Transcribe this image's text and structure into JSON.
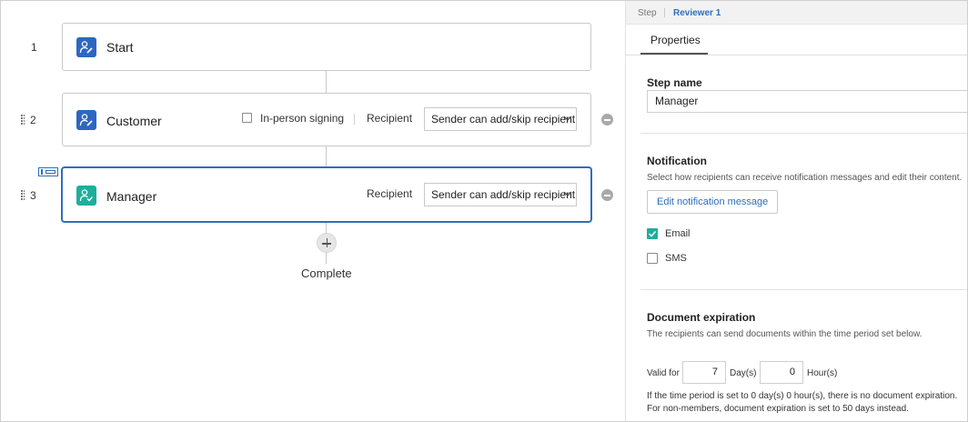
{
  "flow": {
    "steps": [
      {
        "number": "1",
        "title": "Start"
      },
      {
        "number": "2",
        "title": "Customer",
        "checkbox_label": "In-person signing",
        "recipient_label": "Recipient",
        "recipient_value": "Sender can add/skip recipient"
      },
      {
        "number": "3",
        "title": "Manager",
        "recipient_label": "Recipient",
        "recipient_value": "Sender can add/skip recipient"
      }
    ],
    "complete_label": "Complete"
  },
  "panel": {
    "breadcrumb": {
      "step": "Step",
      "current": "Reviewer 1"
    },
    "tab": "Properties",
    "step_name": {
      "title": "Step name",
      "value": "Manager"
    },
    "notification": {
      "title": "Notification",
      "description": "Select how recipients can receive notification messages and edit their content.",
      "edit_button": "Edit notification message",
      "email_label": "Email",
      "email_checked": true,
      "sms_label": "SMS",
      "sms_checked": false
    },
    "expiration": {
      "title": "Document expiration",
      "description": "The recipients can send documents within the time period set below.",
      "valid_for": "Valid for",
      "days_value": "7",
      "days_unit": "Day(s)",
      "hours_value": "0",
      "hours_unit": "Hour(s)",
      "note1": "If the time period is set to 0 day(s) 0 hour(s), there is no document expiration.",
      "note2": "For non-members, document expiration is set to 50 days instead."
    }
  },
  "colors": {
    "accent": "#2d6fbf",
    "start_icon": "#2e67c1",
    "manager_icon": "#1fae9b",
    "check": "#1fae9b"
  },
  "icons": [
    "user-edit-icon",
    "user-check-icon",
    "drag-handle-icon",
    "minus-circle-icon",
    "plus-circle-icon",
    "chevron-down-icon",
    "checkmark-icon",
    "order-tag-icon"
  ]
}
